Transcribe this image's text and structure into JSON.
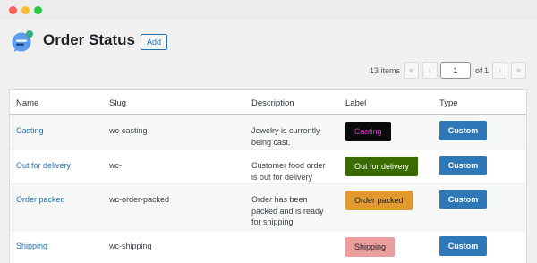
{
  "page": {
    "title": "Order Status",
    "add_label": "Add"
  },
  "pagination": {
    "items_text": "13 items",
    "first": "«",
    "prev": "‹",
    "current": "1",
    "of_text": "of 1",
    "next": "›",
    "last": "»"
  },
  "table": {
    "headers": [
      "Name",
      "Slug",
      "Description",
      "Label",
      "Type"
    ],
    "rows": [
      {
        "name": "Casting",
        "slug": "wc-casting",
        "description": "Jewelry is currently being cast.",
        "label": "Casting",
        "label_bg": "#0a0a0a",
        "label_fg": "#e02ee0",
        "type": "Custom"
      },
      {
        "name": "Out for delivery",
        "slug": "wc-",
        "description": "Customer food order is out for delivery",
        "label": "Out for delivery",
        "label_bg": "#3a6b00",
        "label_fg": "#ffffff",
        "type": "Custom"
      },
      {
        "name": "Order packed",
        "slug": "wc-order-packed",
        "description": "Order has been packed and is ready for shipping",
        "label": "Order packed",
        "label_bg": "#e29a2f",
        "label_fg": "#1d2327",
        "type": "Custom"
      },
      {
        "name": "Shipping",
        "slug": "wc-shipping",
        "description": "",
        "label": "Shipping",
        "label_bg": "#ea9e9e",
        "label_fg": "#1d2327",
        "type": "Custom"
      }
    ]
  }
}
